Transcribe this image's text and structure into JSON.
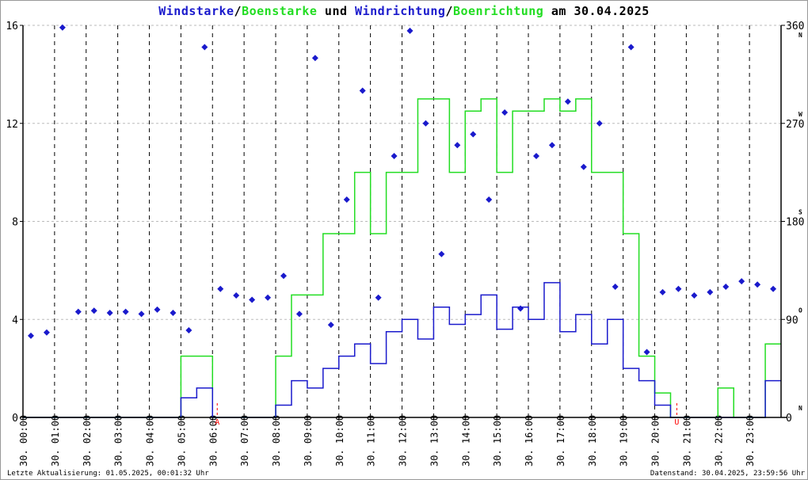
{
  "title": {
    "parts": [
      "Windstarke",
      "/",
      "Boenstarke",
      " und ",
      "Windrichtung",
      "/",
      "Boenrichtung",
      " am 30.04.2025"
    ]
  },
  "footer": {
    "left": "Letzte Aktualisierung: 01.05.2025, 00:01:32 Uhr",
    "right": "Datenstand: 30.04.2025, 23:59:56 Uhr"
  },
  "colors": {
    "speed": "#1a1acc",
    "gust": "#22dd22",
    "direction": "#1a1acc",
    "sun_marker": "#ff0000"
  },
  "chart_data": {
    "type": "line",
    "title": "Windstarke/Boenstarke und Windrichtung/Boenrichtung am 30.04.2025",
    "xlabel": "",
    "ylabel": "",
    "xlim": [
      0,
      24
    ],
    "ylim": [
      0,
      16
    ],
    "y2lim": [
      0,
      360
    ],
    "x_tick_labels": [
      "30. 00:00",
      "30. 01:00",
      "30. 02:00",
      "30. 03:00",
      "30. 04:00",
      "30. 05:00",
      "30. 06:00",
      "30. 07:00",
      "30. 08:00",
      "30. 09:00",
      "30. 10:00",
      "30. 11:00",
      "30. 12:00",
      "30. 13:00",
      "30. 14:00",
      "30. 15:00",
      "30. 16:00",
      "30. 17:00",
      "30. 18:00",
      "30. 19:00",
      "30. 20:00",
      "30. 21:00",
      "30. 22:00",
      "30. 23:00"
    ],
    "y_ticks": [
      "0",
      "4",
      "8",
      "12",
      "16"
    ],
    "y2_ticks": [
      {
        "v": "0",
        "d": "N"
      },
      {
        "v": "90",
        "d": "O"
      },
      {
        "v": "180",
        "d": "S"
      },
      {
        "v": "270",
        "d": "W"
      },
      {
        "v": "360",
        "d": "N"
      }
    ],
    "y2_tick_values": [
      0,
      90,
      180,
      270,
      360
    ],
    "grid": true,
    "sun_markers": [
      {
        "label": "A",
        "hour": 6.15
      },
      {
        "label": "U",
        "hour": 20.7
      }
    ],
    "x": [
      0,
      0.5,
      1,
      1.5,
      2,
      2.5,
      3,
      3.5,
      4,
      4.5,
      5,
      5.5,
      6,
      6.5,
      7,
      7.5,
      8,
      8.5,
      9,
      9.5,
      10,
      10.5,
      11,
      11.5,
      12,
      12.5,
      13,
      13.5,
      14,
      14.5,
      15,
      15.5,
      16,
      16.5,
      17,
      17.5,
      18,
      18.5,
      19,
      19.5,
      20,
      20.5,
      21,
      21.5,
      22,
      22.5,
      23,
      23.5
    ],
    "series": [
      {
        "name": "Windstarke",
        "axis": "left",
        "values": [
          0,
          0,
          0,
          0,
          0,
          0,
          0,
          0,
          0,
          0,
          0.8,
          1.2,
          0,
          0,
          0,
          0,
          0.5,
          1.5,
          1.2,
          2,
          2.5,
          3,
          2.2,
          3.5,
          4,
          3.2,
          4.5,
          3.8,
          4.2,
          5,
          3.6,
          4.5,
          4,
          5.5,
          3.5,
          4.2,
          3,
          4,
          2,
          1.5,
          0.5,
          0,
          0,
          0,
          0,
          0,
          0,
          1.5
        ]
      },
      {
        "name": "Boenstarke",
        "axis": "left",
        "values": [
          0,
          0,
          0,
          0,
          0,
          0,
          0,
          0,
          0,
          0,
          2.5,
          2.5,
          0,
          0,
          0,
          0,
          2.5,
          5,
          5,
          7.5,
          7.5,
          10,
          7.5,
          10,
          10,
          13,
          13,
          10,
          12.5,
          13,
          10,
          12.5,
          12.5,
          13,
          12.5,
          13,
          10,
          10,
          7.5,
          2.5,
          1,
          0,
          0,
          0,
          1.2,
          0,
          0,
          3
        ]
      },
      {
        "name": "Windrichtung",
        "axis": "right",
        "values": [
          75,
          78,
          358,
          97,
          98,
          96,
          97,
          95,
          99,
          96,
          80,
          340,
          118,
          112,
          108,
          110,
          130,
          95,
          330,
          85,
          200,
          300,
          110,
          240,
          355,
          270,
          150,
          250,
          260,
          200,
          280,
          100,
          240,
          250,
          290,
          230,
          270,
          120,
          340,
          60,
          115,
          118,
          112,
          115,
          120,
          125,
          122,
          118
        ]
      }
    ]
  }
}
